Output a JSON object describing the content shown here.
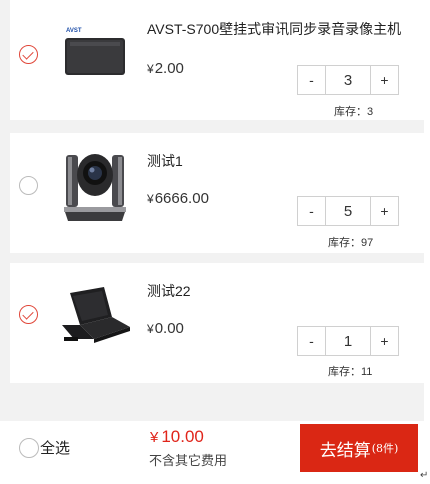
{
  "items": [
    {
      "title": "AVST-S700壁挂式审讯同步录音录像主机",
      "brand_text": "AVST",
      "price": "2.00",
      "currency": "¥",
      "qty": "3",
      "stock_label": "库存：3",
      "checked": true
    },
    {
      "title": "测试1",
      "price": "6666.00",
      "currency": "¥",
      "qty": "5",
      "stock_label": "库存：97",
      "checked": false
    },
    {
      "title": "测试22",
      "price": "0.00",
      "currency": "¥",
      "qty": "1",
      "stock_label": "库存：11",
      "checked": true
    }
  ],
  "stepper": {
    "minus": "-",
    "plus": "+"
  },
  "footer": {
    "select_all_label": "全选",
    "currency": "¥",
    "total": "10.00",
    "note": "不含其它费用",
    "checkout_label": "去结算",
    "checkout_count": "(8件)"
  },
  "return_mark": "↵",
  "colors": {
    "accent": "#da2714",
    "price_red": "#e0251b",
    "check_red": "#e0473a",
    "background": "#f2f2f2"
  },
  "icons": [
    "check-circle-icon",
    "minus-icon",
    "plus-icon"
  ]
}
